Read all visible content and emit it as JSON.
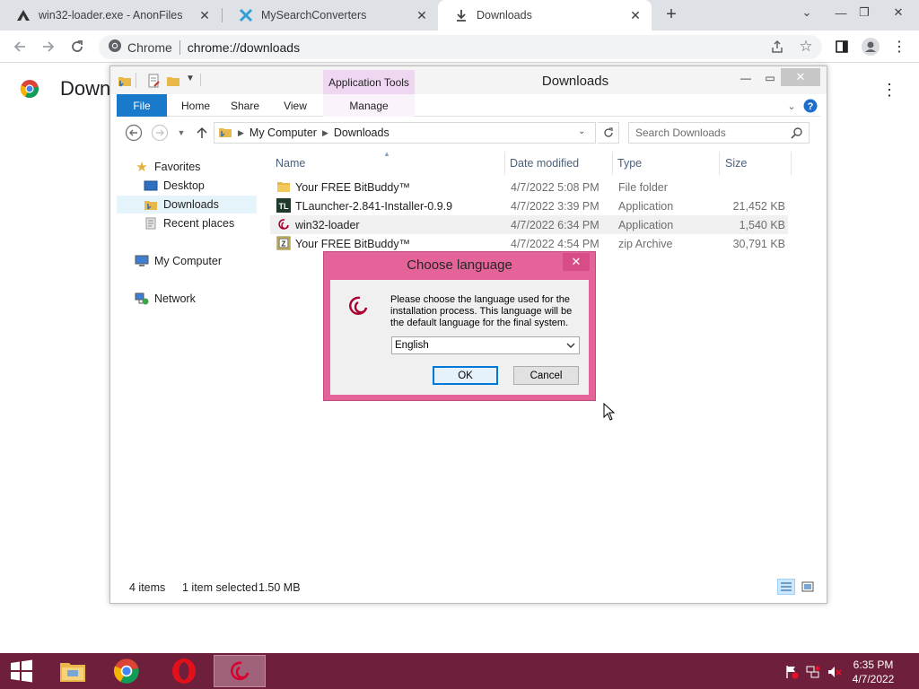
{
  "browser": {
    "tabs": [
      {
        "label": "win32-loader.exe - AnonFiles",
        "icon": "anonfiles-icon",
        "active": false
      },
      {
        "label": "MySearchConverters",
        "icon": "mysearch-icon",
        "active": false
      },
      {
        "label": "Downloads",
        "icon": "download-icon",
        "active": true
      }
    ],
    "omnibox": {
      "site": "Chrome",
      "url": "chrome://downloads"
    },
    "page_title": "Down"
  },
  "explorer": {
    "title": "Downloads",
    "contextual_tab": "Application Tools",
    "ribbon_tabs": [
      "File",
      "Home",
      "Share",
      "View",
      "Manage"
    ],
    "breadcrumb": [
      "My Computer",
      "Downloads"
    ],
    "search_placeholder": "Search Downloads",
    "nav": {
      "favorites": "Favorites",
      "desktop": "Desktop",
      "downloads": "Downloads",
      "recent": "Recent places",
      "computer": "My Computer",
      "network": "Network"
    },
    "columns": {
      "name": "Name",
      "date": "Date modified",
      "type": "Type",
      "size": "Size"
    },
    "files": [
      {
        "name": "Your FREE BitBuddy™",
        "date": "4/7/2022 5:08 PM",
        "type": "File folder",
        "size": "",
        "icon": "folder-icon"
      },
      {
        "name": "TLauncher-2.841-Installer-0.9.9",
        "date": "4/7/2022 3:39 PM",
        "type": "Application",
        "size": "21,452 KB",
        "icon": "tlauncher-icon"
      },
      {
        "name": "win32-loader",
        "date": "4/7/2022 6:34 PM",
        "type": "Application",
        "size": "1,540 KB",
        "icon": "debian-icon"
      },
      {
        "name": "Your FREE BitBuddy™",
        "date": "4/7/2022 4:54 PM",
        "type": "zip Archive",
        "size": "30,791 KB",
        "icon": "zip-icon"
      }
    ],
    "status": {
      "items": "4 items",
      "selected": "1 item selected",
      "size": "1.50 MB"
    }
  },
  "dialog": {
    "title": "Choose language",
    "message": "Please choose the language used for the installation process. This language will be the default language for the final system.",
    "selected_language": "English",
    "ok_label": "OK",
    "cancel_label": "Cancel"
  },
  "taskbar": {
    "time": "6:35 PM",
    "date": "4/7/2022"
  },
  "colors": {
    "taskbar": "#6e1f3b",
    "dialog_frame": "#e4649a",
    "file_tab": "#1979ca",
    "contextual_tab": "#efd7f1"
  }
}
